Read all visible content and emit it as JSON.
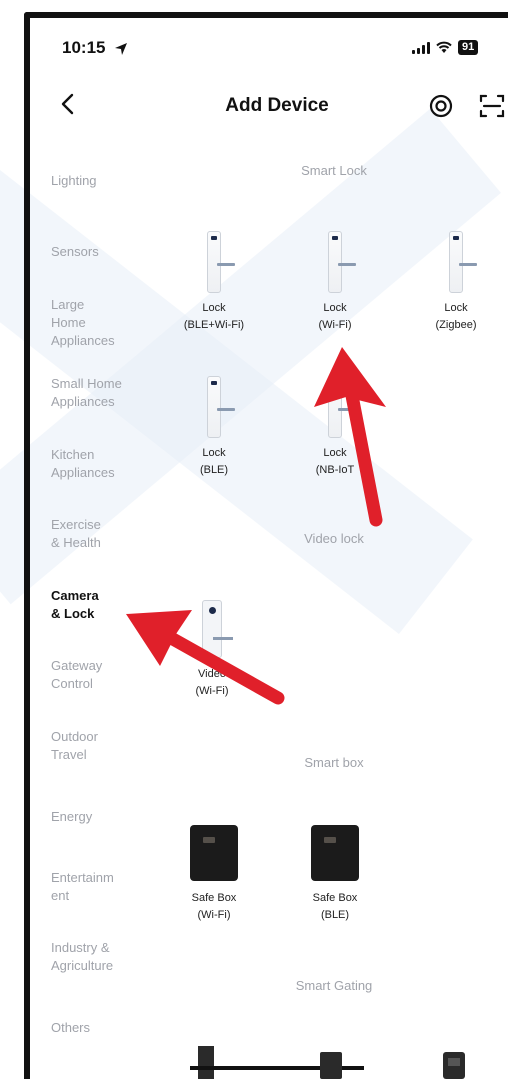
{
  "status_bar": {
    "time": "10:15",
    "battery": "91"
  },
  "header": {
    "title": "Add Device"
  },
  "categories": [
    {
      "label": "Lighting",
      "active": false
    },
    {
      "label": "Sensors",
      "active": false
    },
    {
      "label": "Large\nHome\nAppliances",
      "active": false
    },
    {
      "label": "Small Home\nAppliances",
      "active": false
    },
    {
      "label": "Kitchen\nAppliances",
      "active": false
    },
    {
      "label": "Exercise\n& Health",
      "active": false
    },
    {
      "label": "Camera\n& Lock",
      "active": true
    },
    {
      "label": "Gateway\nControl",
      "active": false
    },
    {
      "label": "Outdoor\nTravel",
      "active": false
    },
    {
      "label": "Energy",
      "active": false
    },
    {
      "label": "Entertainm\nent",
      "active": false
    },
    {
      "label": "Industry &\nAgriculture",
      "active": false
    },
    {
      "label": "Others",
      "active": false
    }
  ],
  "sections": {
    "smart_lock": {
      "title": "Smart Lock",
      "devices": [
        {
          "label": "Lock\n(BLE+Wi-Fi)"
        },
        {
          "label": "Lock\n(Wi-Fi)"
        },
        {
          "label": "Lock\n(Zigbee)"
        },
        {
          "label": "Lock\n(BLE)"
        },
        {
          "label": "Lock\n(NB-IoT"
        }
      ]
    },
    "video_lock": {
      "title": "Video lock",
      "devices": [
        {
          "label": "Video\n(Wi-Fi)"
        }
      ]
    },
    "smart_box": {
      "title": "Smart box",
      "devices": [
        {
          "label": "Safe Box\n(Wi-Fi)"
        },
        {
          "label": "Safe Box\n(BLE)"
        }
      ]
    },
    "smart_gating": {
      "title": "Smart Gating"
    }
  },
  "annotation_color": "#e0202a"
}
